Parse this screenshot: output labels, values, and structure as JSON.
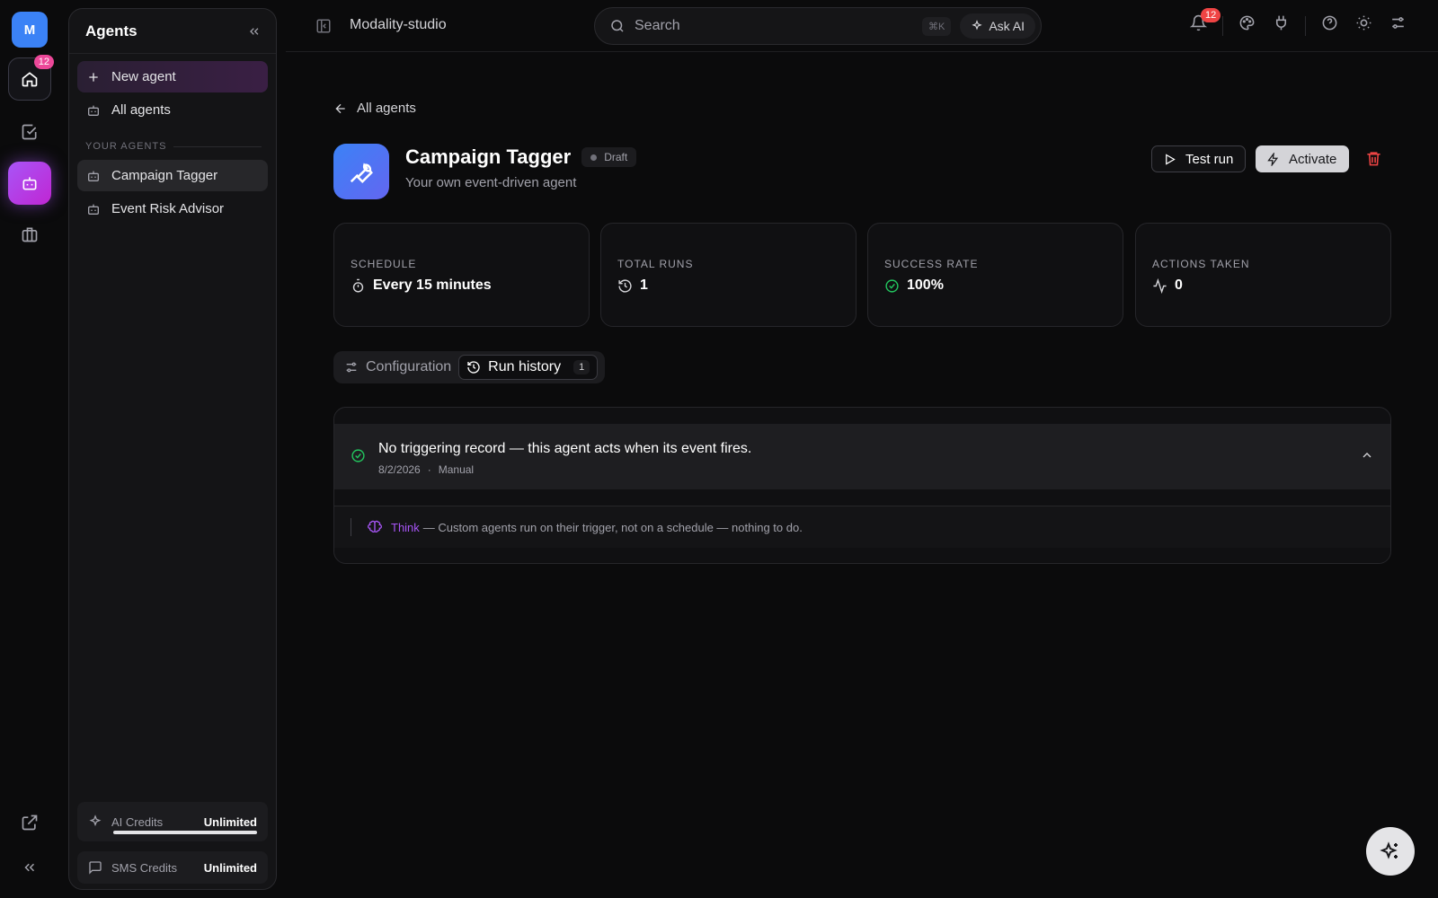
{
  "rail": {
    "workspace_initial": "M",
    "home_badge": "12"
  },
  "panel": {
    "title": "Agents",
    "new_agent": "New agent",
    "all_agents": "All agents",
    "section_label": "YOUR AGENTS",
    "agents": [
      "Campaign Tagger",
      "Event Risk Advisor"
    ],
    "credits": {
      "ai_label": "AI Credits",
      "ai_value": "Unlimited",
      "sms_label": "SMS Credits",
      "sms_value": "Unlimited"
    }
  },
  "topbar": {
    "project": "Modality-studio",
    "search_placeholder": "Search",
    "shortcut": "⌘K",
    "ask_ai": "Ask AI",
    "notif_badge": "12"
  },
  "agent": {
    "back": "All agents",
    "name": "Campaign Tagger",
    "status": "Draft",
    "subtitle": "Your own event-driven agent",
    "test_run": "Test run",
    "activate": "Activate"
  },
  "stats": [
    {
      "label": "SCHEDULE",
      "value": "Every 15 minutes",
      "icon": "timer-icon"
    },
    {
      "label": "TOTAL RUNS",
      "value": "1",
      "icon": "history-icon"
    },
    {
      "label": "SUCCESS RATE",
      "value": "100%",
      "icon": "check-circle-icon"
    },
    {
      "label": "ACTIONS TAKEN",
      "value": "0",
      "icon": "activity-icon"
    }
  ],
  "tabs": {
    "configuration": "Configuration",
    "run_history": "Run history",
    "run_history_count": "1"
  },
  "run": {
    "title": "No triggering record — this agent acts when its event fires.",
    "date": "8/2/2026",
    "dot": "·",
    "trigger": "Manual",
    "step_label": "Think",
    "step_text": "— Custom agents run on their trigger, not on a schedule — nothing to do."
  },
  "colors": {
    "accent_purple": "#a855f7",
    "agent_icon_blue": "#3b82f6",
    "success_green": "#22c55e",
    "danger_red": "#ef4444",
    "badge_pink": "#ec4899"
  }
}
